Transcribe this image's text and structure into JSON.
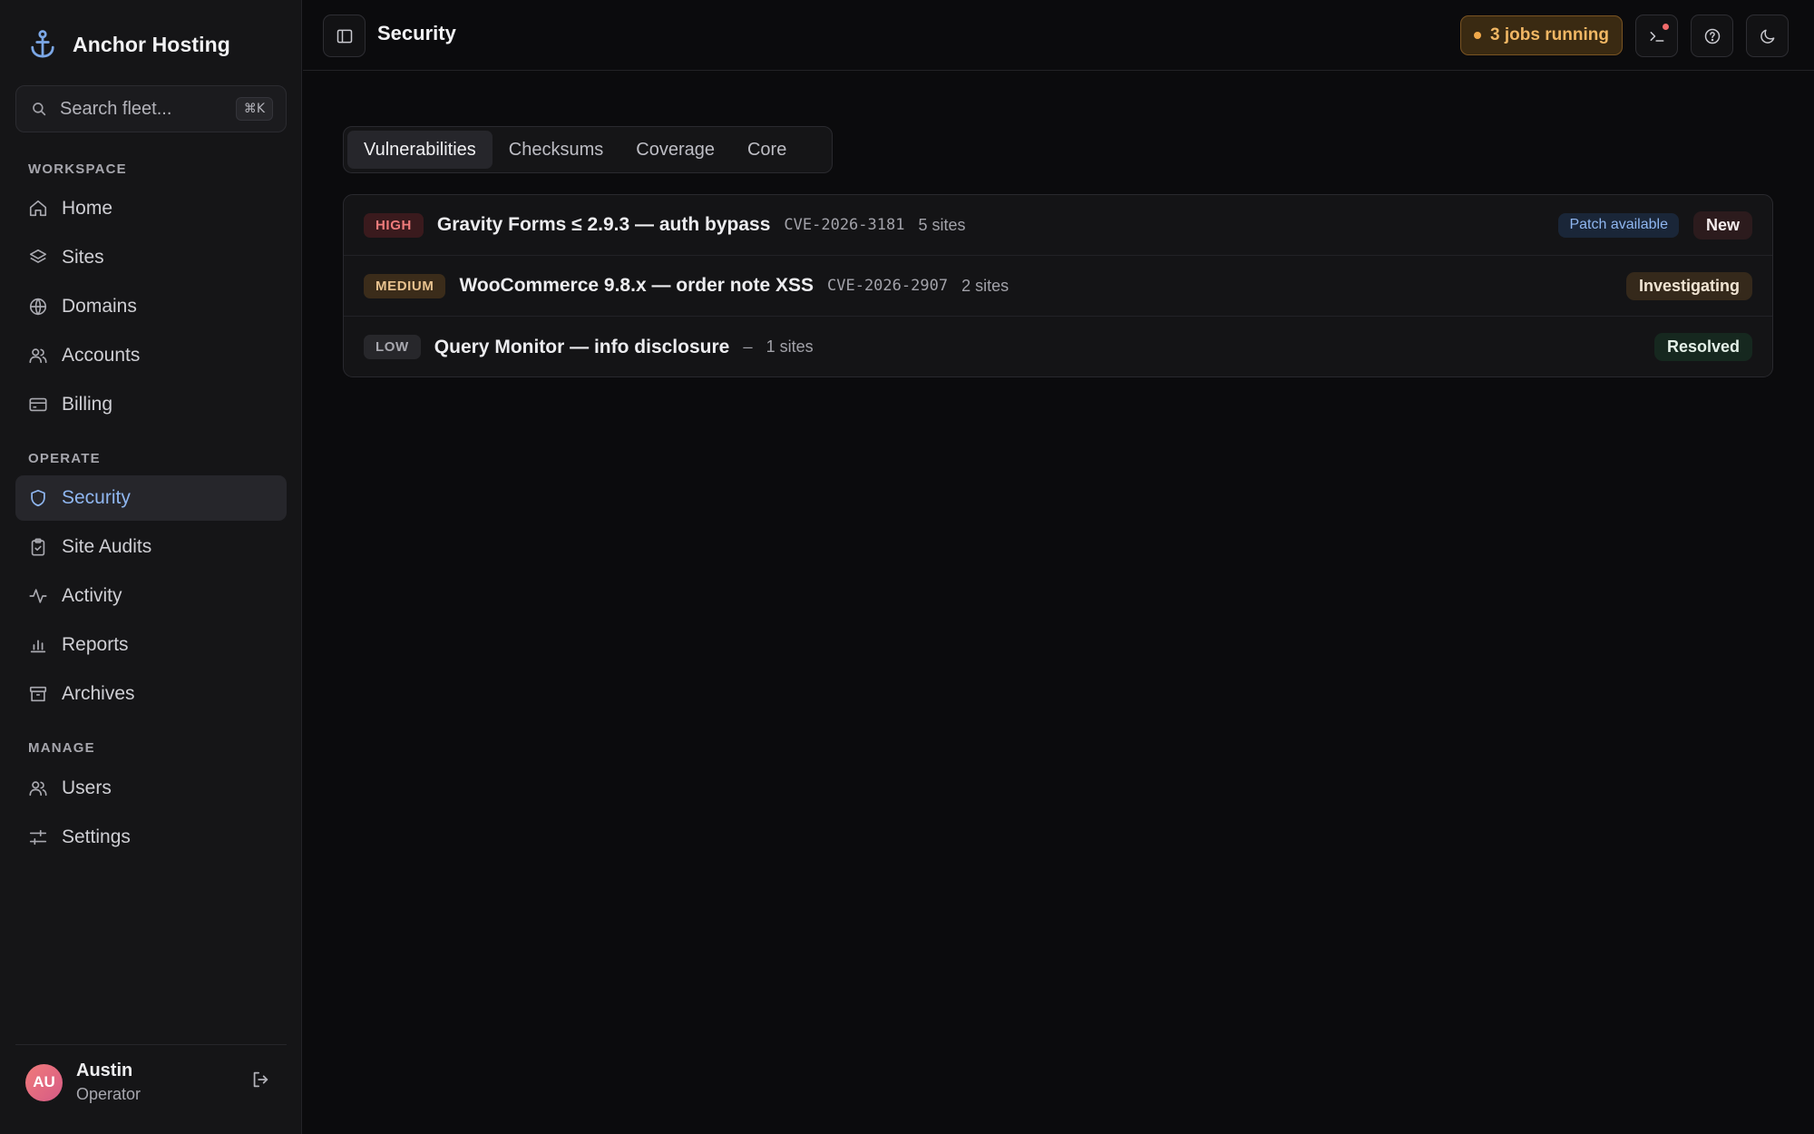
{
  "app": {
    "brand_name": "Anchor Hosting",
    "brand_icon": "anchor-icon",
    "accent_color": "#8fb6f0"
  },
  "search": {
    "placeholder": "Search fleet...",
    "shortcut": "⌘K"
  },
  "nav": {
    "sections": [
      {
        "label": "WORKSPACE",
        "items": [
          {
            "label": "Home",
            "icon": "home-icon"
          },
          {
            "label": "Sites",
            "icon": "layers-icon"
          },
          {
            "label": "Domains",
            "icon": "globe-icon"
          },
          {
            "label": "Accounts",
            "icon": "users-icon"
          },
          {
            "label": "Billing",
            "icon": "credit-card-icon"
          }
        ]
      },
      {
        "label": "OPERATE",
        "items": [
          {
            "label": "Security",
            "icon": "shield-icon",
            "active": true
          },
          {
            "label": "Site Audits",
            "icon": "clipboard-icon"
          },
          {
            "label": "Activity",
            "icon": "activity-icon"
          },
          {
            "label": "Reports",
            "icon": "bar-chart-icon"
          },
          {
            "label": "Archives",
            "icon": "archive-icon"
          }
        ]
      },
      {
        "label": "MANAGE",
        "items": [
          {
            "label": "Users",
            "icon": "users-icon"
          },
          {
            "label": "Settings",
            "icon": "sliders-icon"
          }
        ]
      }
    ]
  },
  "user": {
    "initials": "AU",
    "name": "Austin",
    "role": "Operator"
  },
  "header": {
    "title": "Security",
    "jobs_label": "3 jobs running",
    "jobs_color": "#f1b764"
  },
  "tabs": [
    {
      "label": "Vulnerabilities",
      "active": true
    },
    {
      "label": "Checksums"
    },
    {
      "label": "Coverage"
    },
    {
      "label": "Core"
    }
  ],
  "vulnerabilities": [
    {
      "severity": "HIGH",
      "title": "Gravity Forms ≤ 2.9.3 — auth bypass",
      "cve": "CVE-2026-3181",
      "sites": "5 sites",
      "patch": "Patch available",
      "status": "New",
      "severity_color": "#ee7b7b"
    },
    {
      "severity": "MEDIUM",
      "title": "WooCommerce 9.8.x — order note XSS",
      "cve": "CVE-2026-2907",
      "sites": "2 sites",
      "status": "Investigating",
      "severity_color": "#e8c28f"
    },
    {
      "severity": "LOW",
      "title": "Query Monitor — info disclosure",
      "cve": "–",
      "sites": "1 sites",
      "status": "Resolved",
      "severity_color": "#a8a8af"
    }
  ]
}
